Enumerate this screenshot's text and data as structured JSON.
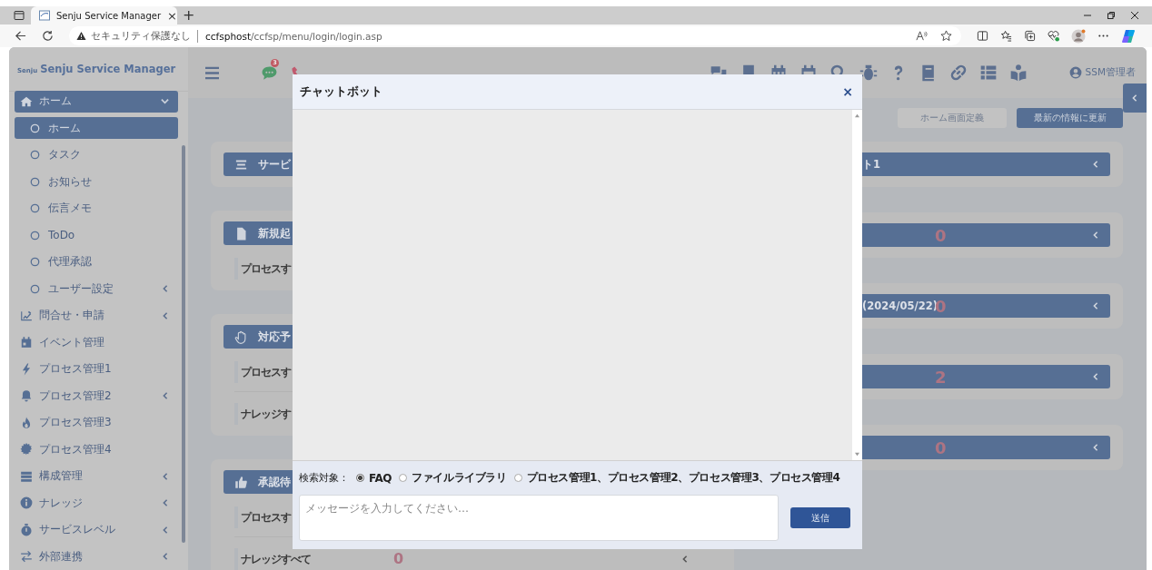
{
  "browser": {
    "tab_title": "Senju Service Manager",
    "tab_close": "×",
    "new_tab": "+",
    "security_label": "セキュリティ保護なし",
    "url_host": "ccfsphost",
    "url_path": "/ccfsp/menu/login/login.asp"
  },
  "header": {
    "logo_mark": "Senju",
    "logo_text": "Senju Service Manager",
    "chat_badge": "3",
    "user": "SSM管理者"
  },
  "sidebar": {
    "items": [
      {
        "label": "ホーム",
        "expanded": true,
        "children": [
          {
            "label": "ホーム",
            "selected": true
          },
          {
            "label": "タスク",
            "selected": false
          },
          {
            "label": "お知らせ",
            "selected": false
          },
          {
            "label": "伝言メモ",
            "selected": false
          },
          {
            "label": "ToDo",
            "selected": false
          },
          {
            "label": "代理承認",
            "selected": false
          },
          {
            "label": "ユーザー設定",
            "selected": false,
            "expanded": false
          }
        ]
      },
      {
        "label": "問合せ・申請",
        "expanded": false
      },
      {
        "label": "イベント管理"
      },
      {
        "label": "プロセス管理1"
      },
      {
        "label": "プロセス管理2",
        "expanded": false
      },
      {
        "label": "プロセス管理3"
      },
      {
        "label": "プロセス管理4"
      },
      {
        "label": "構成管理",
        "expanded": false
      },
      {
        "label": "ナレッジ",
        "expanded": false
      },
      {
        "label": "サービスレベル",
        "expanded": false
      },
      {
        "label": "外部連携",
        "expanded": false
      }
    ]
  },
  "toolbar_buttons": [
    {
      "label": "ホーム画面定義",
      "kind": "secondary"
    },
    {
      "label": "最新の情報に更新",
      "kind": "primary"
    }
  ],
  "left_cards": [
    {
      "title": "サービ"
    },
    {
      "title": "新規起",
      "rows": [
        {
          "label": "プロセスす"
        }
      ]
    },
    {
      "title": "対応予",
      "rows": [
        {
          "label": "プロセスす"
        },
        {
          "label": "ナレッジす"
        }
      ]
    },
    {
      "title": "承認待",
      "rows": [
        {
          "label": "プロセスす"
        },
        {
          "label": "ナレッジすべて",
          "count": "0"
        }
      ]
    }
  ],
  "right_cards": [
    {
      "title": "ト1"
    },
    {
      "count": "0"
    },
    {
      "title": "(2024/05/22)",
      "count": "0"
    },
    {
      "count": "2"
    },
    {
      "count": "0"
    }
  ],
  "chat_dialog": {
    "title": "チャットボット",
    "close": "×",
    "search_label": "検索対象：",
    "targets": [
      {
        "label": "FAQ",
        "selected": true
      },
      {
        "label": "ファイルライブラリ",
        "selected": false
      },
      {
        "label": "プロセス管理1、プロセス管理2、プロセス管理3、プロセス管理4",
        "selected": false
      }
    ],
    "message_placeholder": "メッセージを入力してください…",
    "send": "送信"
  }
}
